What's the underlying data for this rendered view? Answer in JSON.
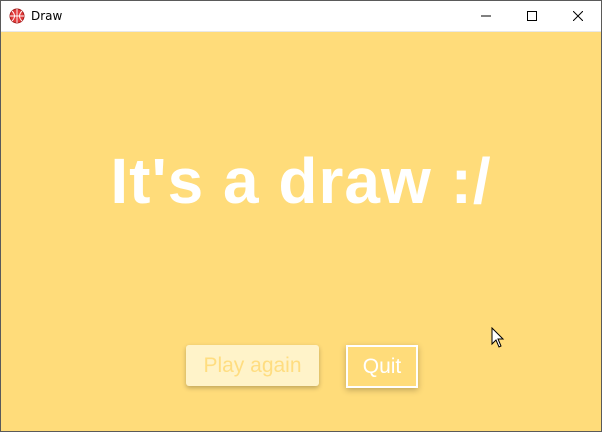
{
  "window": {
    "title": "Draw",
    "icon": "basketball-icon",
    "controls": [
      "minimize-icon",
      "maximize-icon",
      "close-icon"
    ]
  },
  "main": {
    "headline": "It's a draw :/",
    "play_again_label": "Play again",
    "quit_label": "Quit"
  },
  "colors": {
    "background": "#ffdc7a",
    "headline": "#ffffff",
    "play_again_bg": "#fff3c9",
    "play_again_text": "#ffdd80",
    "quit_border": "#ffffff"
  }
}
